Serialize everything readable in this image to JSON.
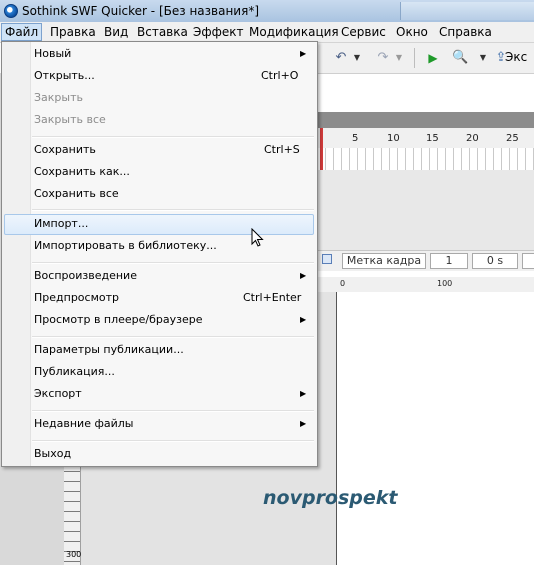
{
  "window": {
    "title": "Sothink SWF Quicker - [Без названия*]"
  },
  "menubar": [
    "Файл",
    "Правка",
    "Вид",
    "Вставка",
    "Эффект",
    "Модификация",
    "Сервис",
    "Окно",
    "Справка"
  ],
  "toolbar": {
    "partial_label": "Экс"
  },
  "timeline": {
    "ruler_numbers": [
      "5",
      "10",
      "15",
      "20",
      "25"
    ]
  },
  "status": {
    "frame_label_placeholder": "Метка кадра",
    "frame": "1",
    "time": "0 s"
  },
  "ruler": {
    "h_numbers": [
      "0",
      "100"
    ],
    "v_number": "300"
  },
  "file_menu": {
    "items": [
      {
        "label": "Новый",
        "shortcut": "",
        "submenu": true,
        "disabled": false
      },
      {
        "label": "Открыть...",
        "shortcut": "Ctrl+O",
        "submenu": false,
        "disabled": false
      },
      {
        "label": "Закрыть",
        "shortcut": "",
        "submenu": false,
        "disabled": true
      },
      {
        "label": "Закрыть все",
        "shortcut": "",
        "submenu": false,
        "disabled": true
      },
      {
        "label": "Сохранить",
        "shortcut": "Ctrl+S",
        "submenu": false,
        "disabled": false
      },
      {
        "label": "Сохранить как...",
        "shortcut": "",
        "submenu": false,
        "disabled": false
      },
      {
        "label": "Сохранить все",
        "shortcut": "",
        "submenu": false,
        "disabled": false
      },
      {
        "label": "Импорт...",
        "shortcut": "",
        "submenu": false,
        "disabled": false
      },
      {
        "label": "Импортировать в библиотеку...",
        "shortcut": "",
        "submenu": false,
        "disabled": false
      },
      {
        "label": "Воспроизведение",
        "shortcut": "",
        "submenu": true,
        "disabled": false
      },
      {
        "label": "Предпросмотр",
        "shortcut": "Ctrl+Enter",
        "submenu": false,
        "disabled": false
      },
      {
        "label": "Просмотр в плеере/браузере",
        "shortcut": "",
        "submenu": true,
        "disabled": false
      },
      {
        "label": "Параметры публикации...",
        "shortcut": "",
        "submenu": false,
        "disabled": false
      },
      {
        "label": "Публикация...",
        "shortcut": "",
        "submenu": false,
        "disabled": false
      },
      {
        "label": "Экспорт",
        "shortcut": "",
        "submenu": true,
        "disabled": false
      },
      {
        "label": "Недавние файлы",
        "shortcut": "",
        "submenu": true,
        "disabled": false
      },
      {
        "label": "Выход",
        "shortcut": "",
        "submenu": false,
        "disabled": false
      }
    ]
  },
  "watermark": "novprospekt"
}
